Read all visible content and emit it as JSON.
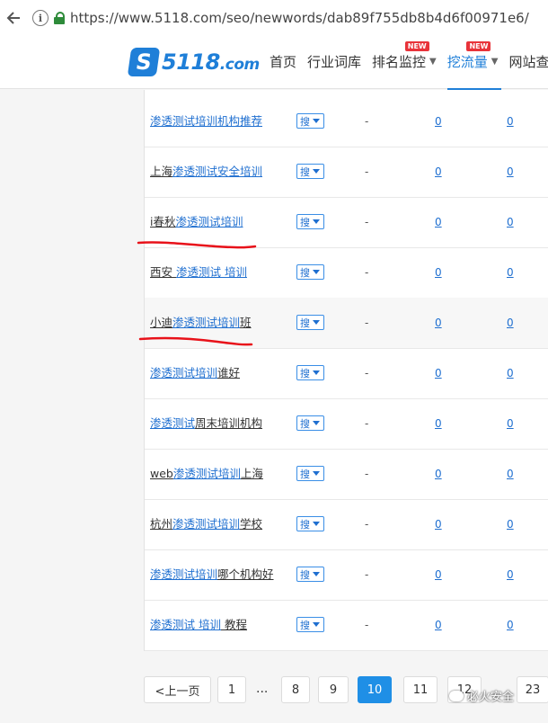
{
  "browser": {
    "url": "https://www.5118.com/seo/newwords/dab89f755db8b4d6f00971e6/"
  },
  "site": {
    "logo": "5118",
    "logo_suffix": ".com",
    "nav": [
      {
        "label": "首页"
      },
      {
        "label": "行业词库"
      },
      {
        "label": "排名监控",
        "badge": "NEW"
      },
      {
        "label": "挖流量",
        "badge": "NEW"
      },
      {
        "label": "网站查询"
      }
    ]
  },
  "rows": [
    {
      "pre": "",
      "link": "渗透测试培训机构推荐",
      "post": "",
      "sou": "搜",
      "dash": "-",
      "v1": "0",
      "v2": "0"
    },
    {
      "pre": "上海",
      "link": "渗透测试安全培训",
      "post": "",
      "sou": "搜",
      "dash": "-",
      "v1": "0",
      "v2": "0"
    },
    {
      "pre": "i春秋",
      "link": "渗透测试培训",
      "post": "",
      "sou": "搜",
      "dash": "-",
      "v1": "0",
      "v2": "0"
    },
    {
      "pre": "西安 ",
      "link": "渗透测试 培训",
      "post": "",
      "sou": "搜",
      "dash": "-",
      "v1": "0",
      "v2": "0"
    },
    {
      "pre": "小迪",
      "link": "渗透测试培训",
      "post": "班",
      "sou": "搜",
      "dash": "-",
      "v1": "0",
      "v2": "0"
    },
    {
      "pre": "",
      "link": "渗透测试培训",
      "post": "谁好",
      "sou": "搜",
      "dash": "-",
      "v1": "0",
      "v2": "0"
    },
    {
      "pre": "",
      "link": "渗透测试",
      "post": "周末培训机构",
      "sou": "搜",
      "dash": "-",
      "v1": "0",
      "v2": "0"
    },
    {
      "pre": "web",
      "link": "渗透测试培训",
      "post": "上海",
      "sou": "搜",
      "dash": "-",
      "v1": "0",
      "v2": "0"
    },
    {
      "pre": "杭州",
      "link": "渗透测试培训",
      "post": "学校",
      "sou": "搜",
      "dash": "-",
      "v1": "0",
      "v2": "0"
    },
    {
      "pre": "",
      "link": "渗透测试培训",
      "post": "哪个机构好",
      "sou": "搜",
      "dash": "-",
      "v1": "0",
      "v2": "0"
    },
    {
      "pre": "",
      "link": "渗透测试 培训",
      "post": " 教程",
      "sou": "搜",
      "dash": "-",
      "v1": "0",
      "v2": "0"
    }
  ],
  "pager": {
    "prev": "<上一页",
    "first": "1",
    "ellipsis": "...",
    "pages": [
      "8",
      "9",
      "10",
      "11",
      "12"
    ],
    "current": "10",
    "last": "23"
  },
  "watermark": "必火安全",
  "colors": {
    "brand": "#1f7fd8",
    "link": "#1f6fd0",
    "current_page": "#1f8fe6",
    "annotation": "#e8121a"
  }
}
